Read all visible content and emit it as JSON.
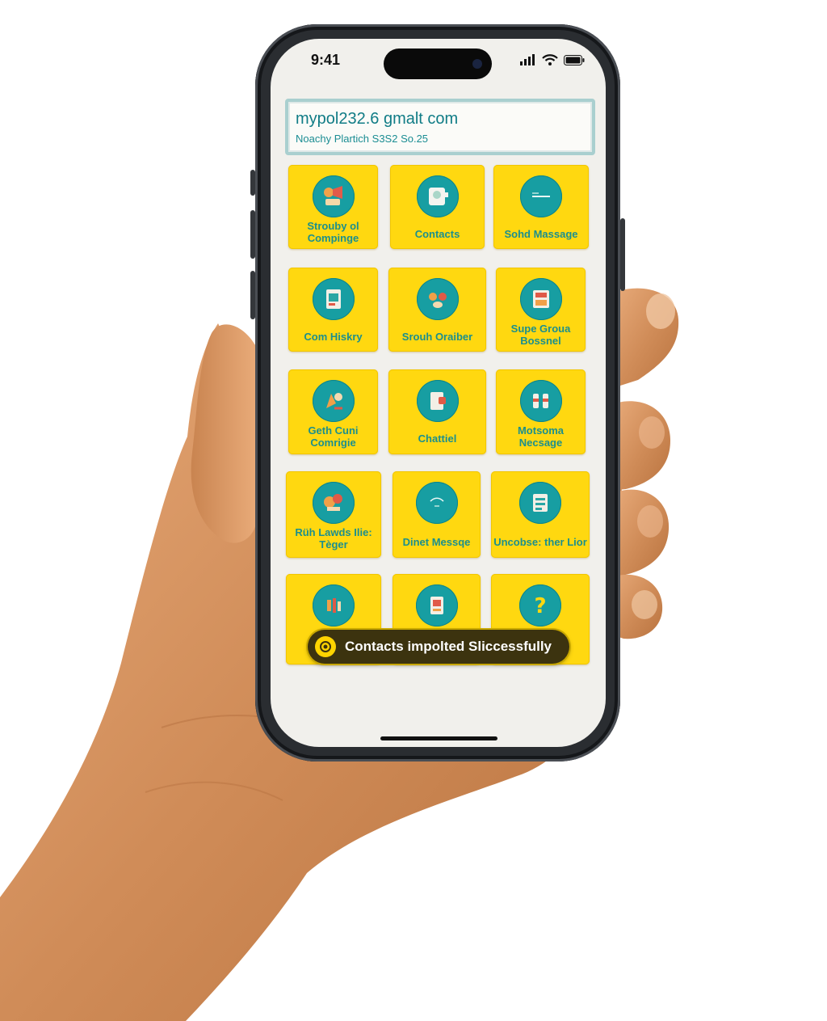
{
  "status_bar": {
    "time": "9:41",
    "icons": [
      "signal-icon",
      "wifi-icon",
      "battery-icon"
    ]
  },
  "account": {
    "email": "mypol232.6 gmalt com",
    "subtitle": "Noachy Plartich S3S2 So.25"
  },
  "tiles": [
    {
      "label": "Strouby ol Compinge",
      "icon": "campaign-icon"
    },
    {
      "label": "Contacts",
      "icon": "contacts-icon"
    },
    {
      "label": "Sohd Massage",
      "icon": "send-message-icon"
    },
    {
      "label": "Com Hiskry",
      "icon": "history-icon"
    },
    {
      "label": "Srouh Oraiber",
      "icon": "group-icon"
    },
    {
      "label": "Supe Groua Bossnel",
      "icon": "super-group-icon"
    },
    {
      "label": "Geth Cuni Comrigie",
      "icon": "get-campaign-icon"
    },
    {
      "label": "Chattiel",
      "icon": "channel-icon"
    },
    {
      "label": "Motsoma Necsage",
      "icon": "bulk-message-icon"
    },
    {
      "label": "Rüh Lawds Ilie: Tèger",
      "icon": "tag-icon"
    },
    {
      "label": "Dinet Messqe",
      "icon": "direct-message-icon"
    },
    {
      "label": "Uncobse: ther Lior",
      "icon": "unsubscribe-list-icon"
    },
    {
      "label": "",
      "icon": "tools-icon"
    },
    {
      "label": "",
      "icon": "document-icon"
    },
    {
      "label": "",
      "icon": "help-icon"
    }
  ],
  "toast": {
    "text": "Contacts impolted Sliccessfully",
    "icon": "success-coin-icon"
  },
  "colors": {
    "tile_yellow": "#ffd810",
    "icon_teal": "#179ea2",
    "label_teal": "#1b8f8d",
    "screen_bg": "#f1f0ec",
    "toast_bg": "#3c330f"
  }
}
